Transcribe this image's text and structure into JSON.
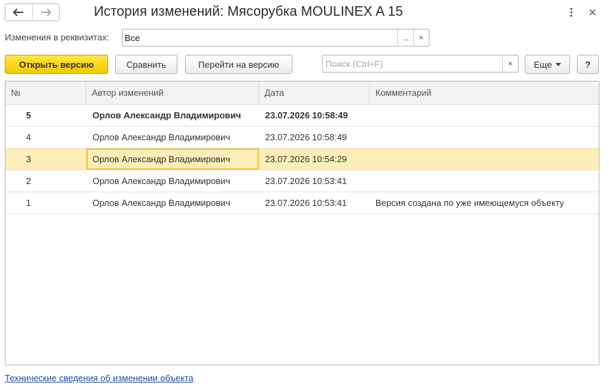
{
  "window": {
    "title": "История изменений: Мясорубка MOULINEX  A 15",
    "back_icon": "arrow-left-icon",
    "forward_icon": "arrow-right-icon",
    "more_icon": "vertical-dots-icon",
    "close_icon": "close-icon"
  },
  "filter": {
    "label": "Изменения в реквизитах:",
    "value": "Все",
    "select_button": "...",
    "clear_button": "×"
  },
  "toolbar": {
    "open_version": "Открыть версию",
    "compare": "Сравнить",
    "go_to_version": "Перейти на версию",
    "search_placeholder": "Поиск (Ctrl+F)",
    "search_clear": "×",
    "more": "Еще",
    "help": "?"
  },
  "table": {
    "columns": [
      "№",
      "Автор изменений",
      "Дата",
      "Комментарий"
    ],
    "rows": [
      {
        "num": "5",
        "author": "Орлов Александр Владимирович",
        "date": "23.07.2026 10:58:49",
        "comment": ""
      },
      {
        "num": "4",
        "author": "Орлов Александр Владимирович",
        "date": "23.07.2026 10:58:49",
        "comment": ""
      },
      {
        "num": "3",
        "author": "Орлов Александр Владимирович",
        "date": "23.07.2026 10:54:29",
        "comment": ""
      },
      {
        "num": "2",
        "author": "Орлов Александр Владимирович",
        "date": "23.07.2026 10:53:41",
        "comment": ""
      },
      {
        "num": "1",
        "author": "Орлов Александр Владимирович",
        "date": "23.07.2026 10:53:41",
        "comment": "Версия создана по уже имеющемуся объекту"
      }
    ],
    "current_row": "5",
    "selected_row": "3"
  },
  "footer": {
    "link": "Технические сведения об изменении объекта"
  },
  "colors": {
    "primary_button": "#f5c900",
    "selected_row": "#fbeeb8",
    "selected_cell_border": "#f2c037",
    "link": "#1a4fa0"
  }
}
